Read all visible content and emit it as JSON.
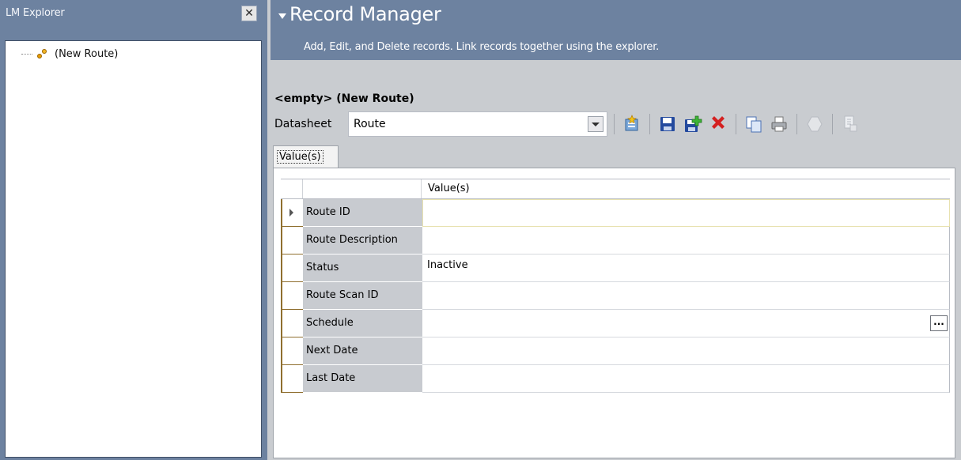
{
  "explorer": {
    "title": "LM Explorer",
    "close_label": "✕",
    "tree": [
      {
        "label": "(New Route)",
        "icon": "route-icon"
      }
    ]
  },
  "banner": {
    "title": "Record Manager",
    "subtitle": "Add, Edit, and Delete records. Link records together using the explorer."
  },
  "record": {
    "title": "<empty> (New Route)"
  },
  "datasheet": {
    "label": "Datasheet",
    "value": "Route"
  },
  "toolbar": {
    "icons": [
      "new-record-icon",
      "save-icon",
      "save-and-new-icon",
      "delete-icon",
      "copy-icon",
      "print-icon",
      "query-icon",
      "report-icon"
    ]
  },
  "tabs": [
    {
      "label": "Value(s)",
      "selected": true
    }
  ],
  "grid": {
    "column_header": "Value(s)",
    "rows": [
      {
        "field": "Route ID",
        "value": ""
      },
      {
        "field": "Route Description",
        "value": ""
      },
      {
        "field": "Status",
        "value": "Inactive"
      },
      {
        "field": "Route Scan ID",
        "value": ""
      },
      {
        "field": "Schedule",
        "value": ""
      },
      {
        "field": "Next Date",
        "value": ""
      },
      {
        "field": "Last Date",
        "value": ""
      }
    ],
    "schedule_button": "..."
  },
  "colors": {
    "panel_blue": "#6d82a0",
    "field_gray": "#c8cbd0",
    "delete_red": "#d42020"
  }
}
